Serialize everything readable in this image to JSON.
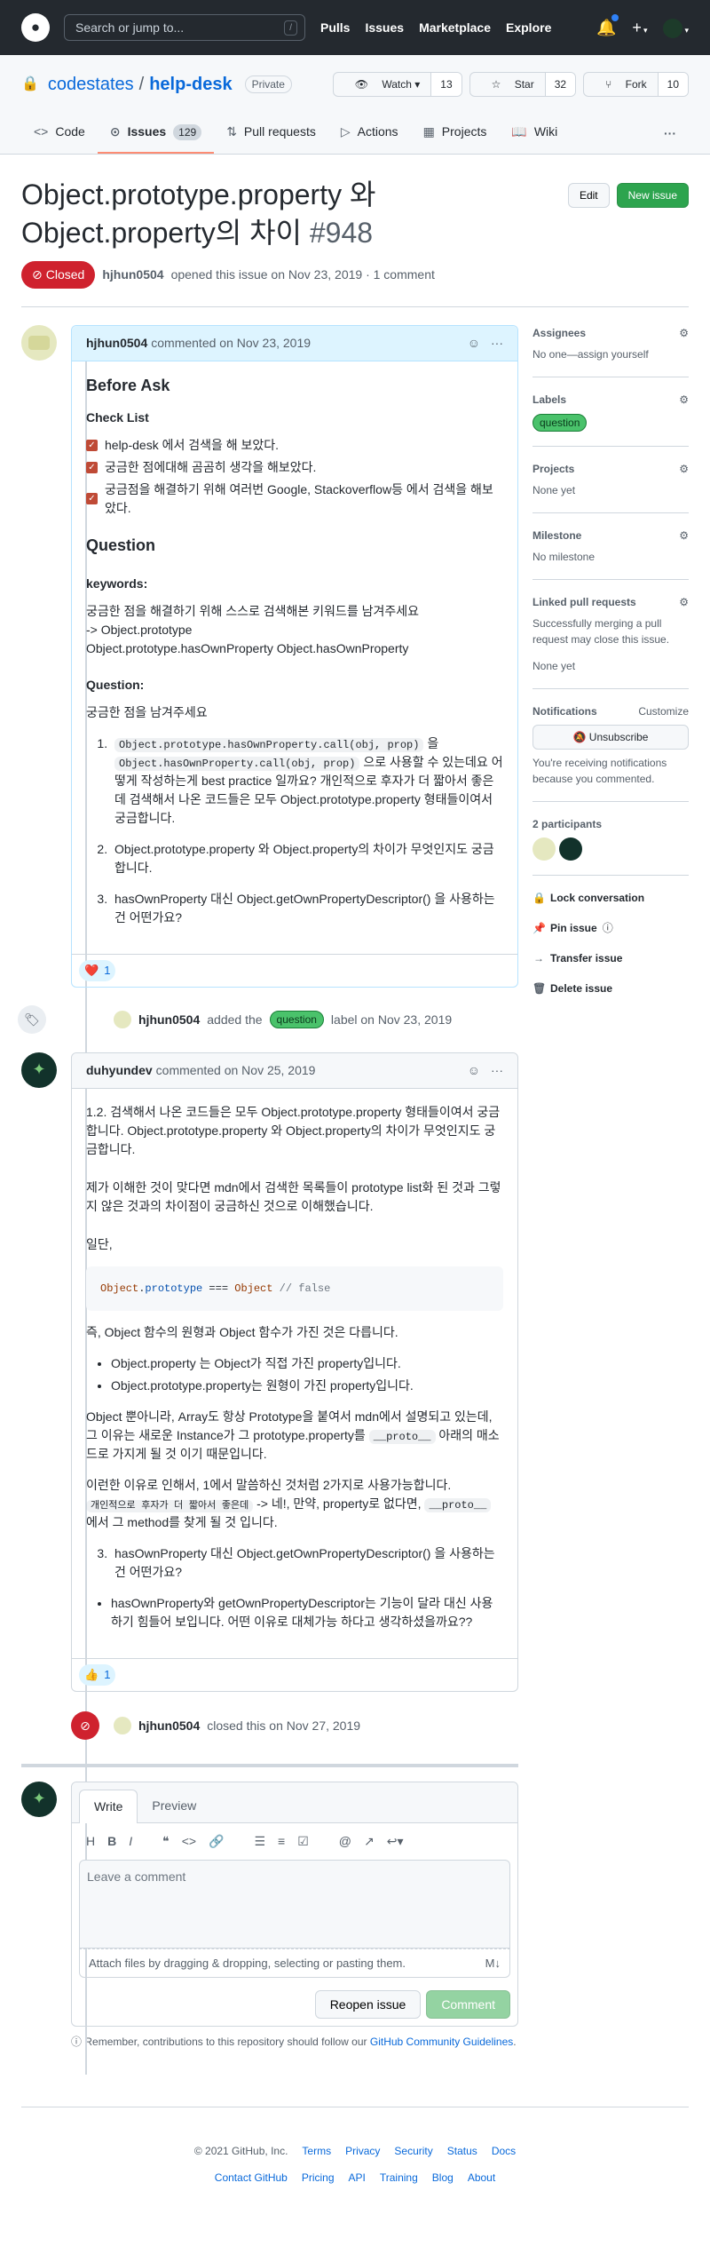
{
  "colors": {
    "accent": "#0969da",
    "closed": "#cf222e",
    "green": "#2da44e",
    "label": "#4ac26b",
    "header": "#24292f"
  },
  "gheader": {
    "search_placeholder": "Search or jump to...",
    "slash": "/",
    "nav": [
      "Pulls",
      "Issues",
      "Marketplace",
      "Explore"
    ]
  },
  "repo": {
    "owner": "codestates",
    "sep": "/",
    "name": "help-desk",
    "visibility": "Private",
    "watch_label": "Watch",
    "watch_count": "13",
    "star_label": "Star",
    "star_count": "32",
    "fork_label": "Fork",
    "fork_count": "10",
    "tabs": [
      {
        "label": "Code",
        "icon": "code-icon"
      },
      {
        "label": "Issues",
        "icon": "issue-icon",
        "count": "129"
      },
      {
        "label": "Pull requests",
        "icon": "pr-icon"
      },
      {
        "label": "Actions",
        "icon": "play-icon"
      },
      {
        "label": "Projects",
        "icon": "project-icon"
      },
      {
        "label": "Wiki",
        "icon": "book-icon"
      }
    ]
  },
  "issue": {
    "title": "Object.prototype.property 와 Object.property의 차이",
    "number": "#948",
    "edit_label": "Edit",
    "new_label": "New issue",
    "state": "Closed",
    "author": "hjhun0504",
    "meta": "opened this issue on Nov 23, 2019 · 1 comment"
  },
  "comment1": {
    "author": "hjhun0504",
    "meta": "commented on Nov 23, 2019",
    "h_before": "Before Ask",
    "h_check": "Check List",
    "checks": [
      "help-desk 에서 검색을 해 보았다.",
      "궁금한 점에대해 곰곰히 생각을 해보았다.",
      "궁금점을 해결하기 위해 여러번 Google, Stackoverflow등 에서 검색을 해보았다."
    ],
    "h_question": "Question",
    "h_keywords": "keywords:",
    "kw_line1": "궁금한 점을 해결하기 위해 스스로 검색해본 키워드를 남겨주세요",
    "kw_line2": "-> Object.prototype",
    "kw_line3": "Object.prototype.hasOwnProperty Object.hasOwnProperty",
    "h_q2": "Question:",
    "q_intro": "궁금한 점을 남겨주세요",
    "q1_code1": "Object.prototype.hasOwnProperty.call(obj, prop)",
    "q1_mid": "을",
    "q1_code2": "Object.hasOwnProperty.call(obj, prop)",
    "q1_rest": "으로 사용할 수 있는데요 어떻게 작성하는게 best practice 일까요? 개인적으로 후자가 더 짧아서 좋은데 검색해서 나온 코드들은 모두 Object.prototype.property 형태들이여서 궁금합니다.",
    "q2": "Object.prototype.property 와 Object.property의 차이가 무엇인지도 궁금합니다.",
    "q3": "hasOwnProperty 대신 Object.getOwnPropertyDescriptor() 을 사용하는건 어떤가요?",
    "reaction_emoji": "❤️",
    "reaction_count": "1"
  },
  "event_label": {
    "author": "hjhun0504",
    "text1": "added the",
    "label": "question",
    "text2": "label on Nov 23, 2019"
  },
  "comment2": {
    "author": "duhyundev",
    "meta": "commented on Nov 25, 2019",
    "p1": "1.2. 검색해서 나온 코드들은 모두 Object.prototype.property 형태들이여서 궁금합니다. Object.prototype.property 와 Object.property의 차이가 무엇인지도 궁금합니다.",
    "p2": "제가 이해한 것이 맞다면 mdn에서 검색한 목록들이 prototype list화 된 것과 그렇지 않은 것과의 차이점이 궁금하신 것으로 이해했습니다.",
    "p3": "일단,",
    "code_obj": "Object",
    "code_dot": ".",
    "code_proto": "prototype",
    "code_eq": " === ",
    "code_obj2": "Object",
    "code_cm": " // false",
    "p4": "즉, Object 함수의 원형과 Object 함수가 가진 것은 다릅니다.",
    "b1": "Object.property 는 Object가 직접 가진 property입니다.",
    "b2": "Object.prototype.property는 원형이 가진 property입니다.",
    "p5a": "Object 뿐아니라, Array도 항상 Prototype을 붙여서 mdn에서 설명되고 있는데, 그 이유는 새로운 Instance가 그 prototype.property를",
    "p5code": "__proto__",
    "p5b": "아래의 매소드로 가지게 될 것 이기 때문입니다.",
    "p6a": "이런한 이유로 인해서, 1에서 말씀하신 것처럼 2가지로 사용가능합니다.",
    "p6code1": "개인적으로 후자가 더 짧아서 좋은데",
    "p6b": "-> 네!, 만약, property로 없다면,",
    "p6code2": "__proto__",
    "p6c": "에서 그 method를 찾게 될 것 입니다.",
    "q3": "hasOwnProperty 대신 Object.getOwnPropertyDescriptor() 을 사용하는건 어떤가요?",
    "b3": "hasOwnProperty와 getOwnPropertyDescriptor는 기능이 달라 대신 사용하기 힘들어 보입니다. 어떤 이유로 대체가능 하다고 생각하셨을까요??",
    "reaction_emoji": "👍",
    "reaction_count": "1"
  },
  "event_closed": {
    "author": "hjhun0504",
    "text": "closed this on Nov 27, 2019"
  },
  "editor": {
    "tab_write": "Write",
    "tab_preview": "Preview",
    "placeholder": "Leave a comment",
    "attach": "Attach files by dragging & dropping, selecting or pasting them.",
    "md": "M↓",
    "reopen": "Reopen issue",
    "comment": "Comment",
    "remember1": "Remember, contributions to this repository should follow our",
    "remember_link": "GitHub Community Guidelines",
    "remember_end": "."
  },
  "sidebar": {
    "assignees_h": "Assignees",
    "assignees_v": "No one—assign yourself",
    "labels_h": "Labels",
    "label": "question",
    "projects_h": "Projects",
    "projects_v": "None yet",
    "milestone_h": "Milestone",
    "milestone_v": "No milestone",
    "linked_h": "Linked pull requests",
    "linked_v1": "Successfully merging a pull request may close this issue.",
    "linked_v2": "None yet",
    "notif_h": "Notifications",
    "notif_custom": "Customize",
    "unsub": "Unsubscribe",
    "notif_v": "You're receiving notifications because you commented.",
    "participants_h": "2 participants",
    "actions": [
      {
        "label": "Lock conversation",
        "icon": "lock-icon"
      },
      {
        "label": "Pin issue",
        "icon": "pin-icon"
      },
      {
        "label": "Transfer issue",
        "icon": "arrow-right-icon"
      },
      {
        "label": "Delete issue",
        "icon": "trash-icon"
      }
    ]
  },
  "footer": {
    "copy": "© 2021 GitHub, Inc.",
    "row1": [
      "Terms",
      "Privacy",
      "Security",
      "Status",
      "Docs"
    ],
    "row2": [
      "Contact GitHub",
      "Pricing",
      "API",
      "Training",
      "Blog",
      "About"
    ]
  }
}
